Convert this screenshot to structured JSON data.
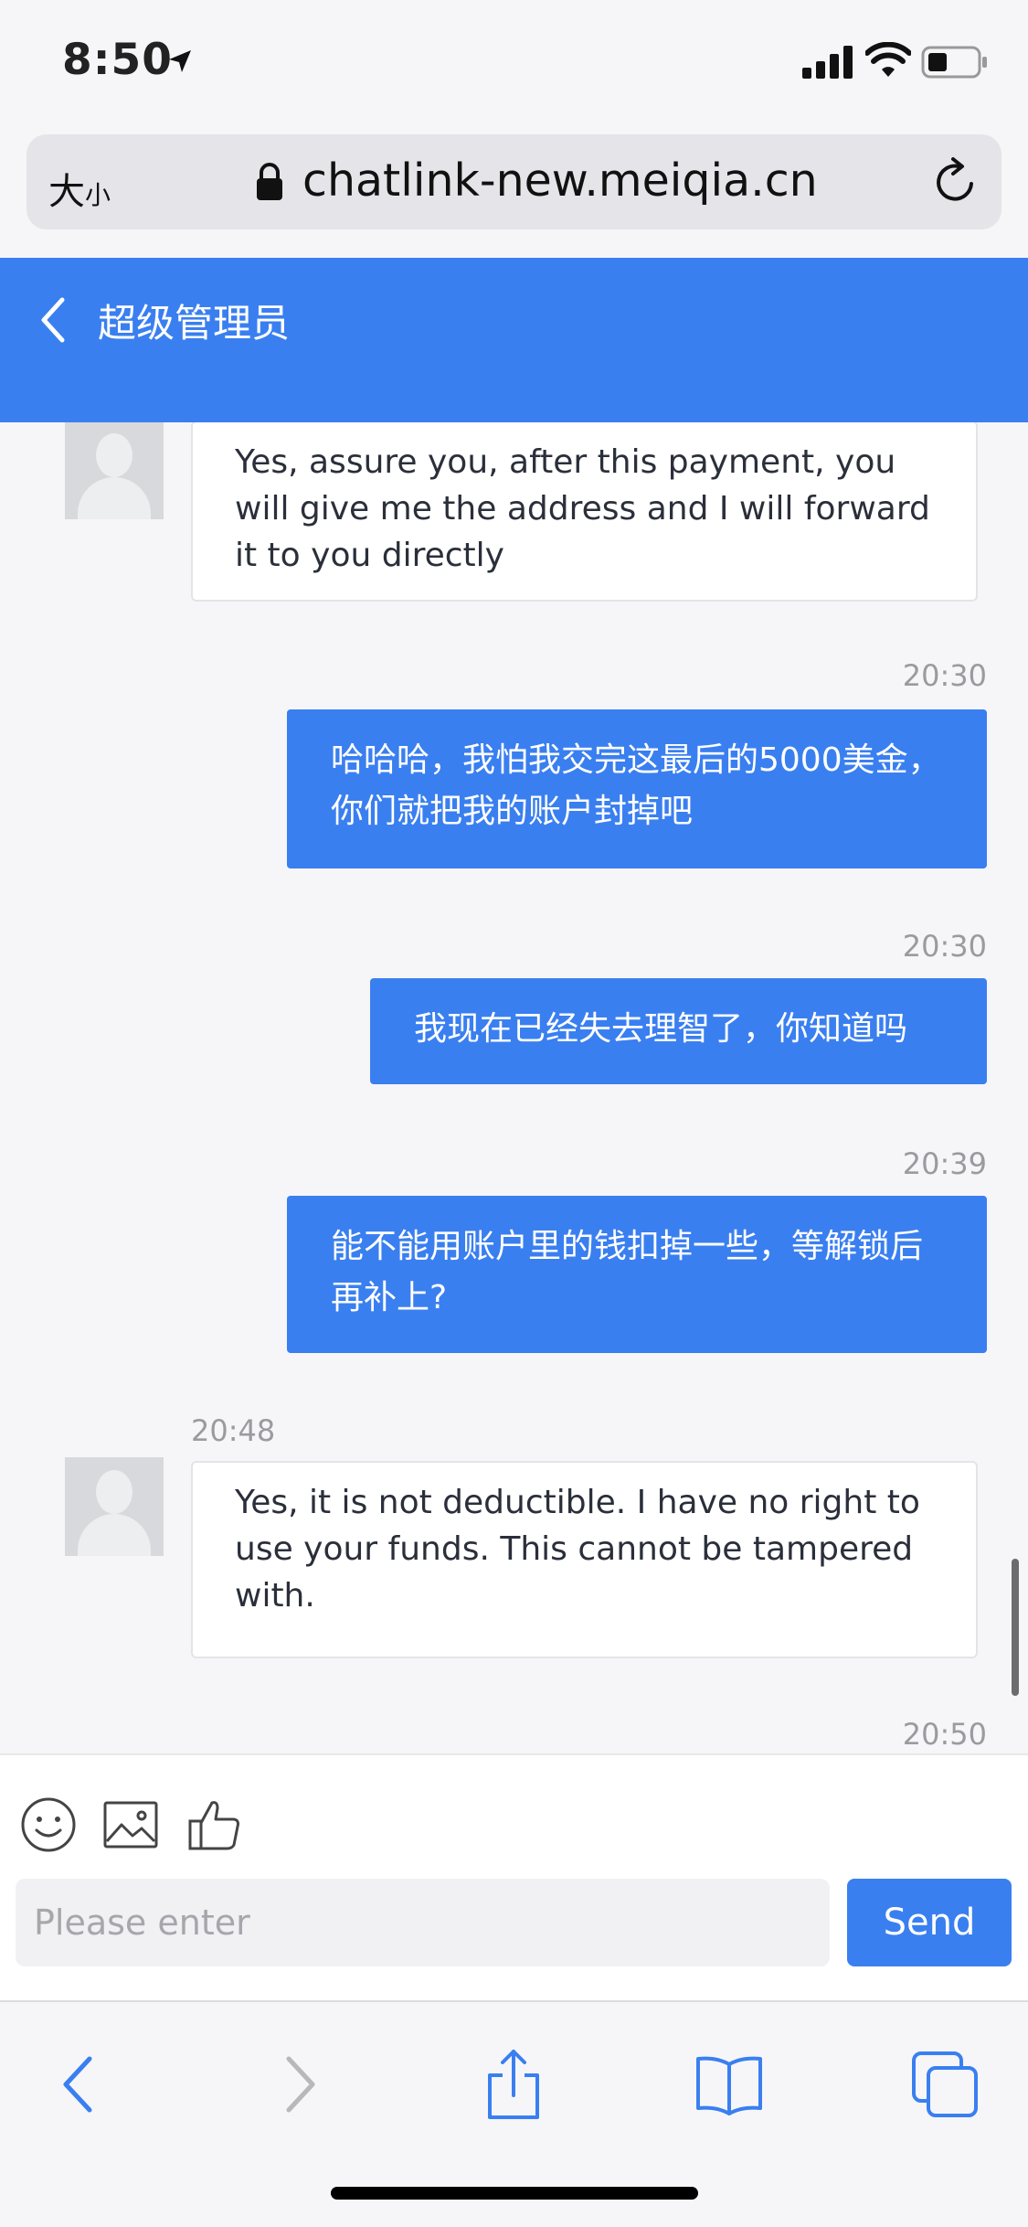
{
  "status_bar": {
    "time": "8:50"
  },
  "url_bar": {
    "text_size_big": "大",
    "text_size_small": "小",
    "url": "chatlink-new.meiqia.cn"
  },
  "chat_header": {
    "title": "超级管理员"
  },
  "messages": [
    {
      "from": "agent",
      "text": "Yes, assure you, after this payment, you will give me the address and I will forward it to you directly"
    },
    {
      "from": "user",
      "time": "20:30",
      "text": "哈哈哈，我怕我交完这最后的5000美金，你们就把我的账户封掉吧"
    },
    {
      "from": "user",
      "time": "20:30",
      "text": "我现在已经失去理智了，你知道吗"
    },
    {
      "from": "user",
      "time": "20:39",
      "text": "能不能用账户里的钱扣掉一些，等解锁后再补上?"
    },
    {
      "from": "agent",
      "time": "20:48",
      "text": "Yes, it is not deductible. I have no right to use your funds. This cannot be tampered with."
    },
    {
      "from": "user",
      "time": "20:50",
      "text": ""
    }
  ],
  "composer": {
    "placeholder": "Please enter",
    "send_label": "Send"
  },
  "colors": {
    "accent": "#3a7ff0",
    "background": "#f6f6f8",
    "bubble_in": "#ffffff"
  },
  "icons": {
    "status": [
      "location-arrow-icon",
      "signal-icon",
      "wifi-icon",
      "battery-icon"
    ],
    "composer_tools": [
      "emoji-icon",
      "image-icon",
      "thumbs-up-icon"
    ],
    "toolbar": [
      "back-icon",
      "forward-icon",
      "share-icon",
      "bookmarks-icon",
      "tabs-icon"
    ]
  }
}
